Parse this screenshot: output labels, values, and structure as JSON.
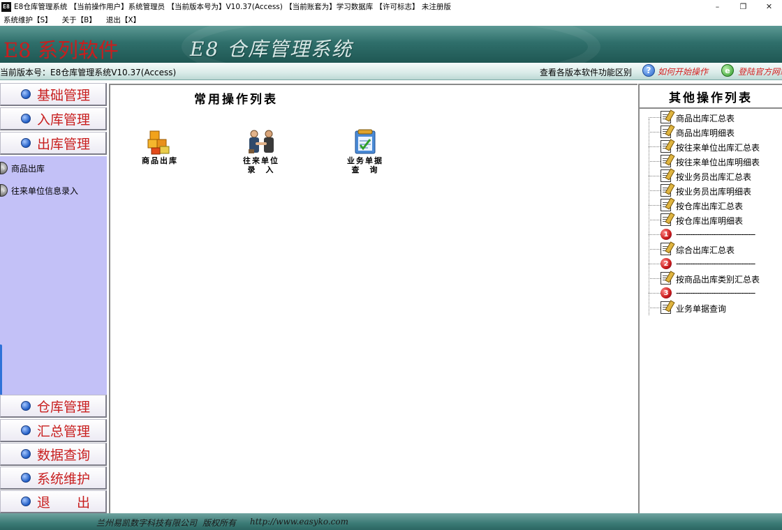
{
  "window": {
    "title": "E8仓库管理系统 【当前操作用户】系统管理员 【当前版本号为】V10.37(Access) 【当前账套为】学习数据库 【许可标志】 未注册版",
    "icon_text": "E8",
    "minimize": "–",
    "restore": "❐",
    "close": "✕"
  },
  "menu": [
    "系统维护【S】",
    "关于【B】",
    "退出【X】"
  ],
  "banner": {
    "brand": "E8 系列软件",
    "system_name": "E8 仓库管理系统",
    "version": "当前版本号：E8仓库管理系统V10.37(Access)",
    "features": "查看各版本软件功能区别",
    "help": "如何开始操作",
    "website": "登陆官方网站"
  },
  "nav_top": [
    "基础管理",
    "入库管理",
    "出库管理"
  ],
  "nav_panel_items": [
    "商品出库",
    "往来单位信息录入"
  ],
  "nav_bottom": [
    "仓库管理",
    "汇总管理",
    "数据查询",
    "系统维护",
    "退　　出"
  ],
  "center": {
    "title": "常用操作列表",
    "tiles": [
      {
        "label": "商品出库",
        "icon": "boxes-icon"
      },
      {
        "label": "往来单位\n录　入",
        "icon": "handshake-icon"
      },
      {
        "label": "业务单据\n查　询",
        "icon": "document-query-icon"
      }
    ]
  },
  "right": {
    "title": "其他操作列表",
    "items": [
      {
        "type": "report",
        "label": "商品出库汇总表"
      },
      {
        "type": "report",
        "label": "商品出库明细表"
      },
      {
        "type": "report",
        "label": "按往来单位出库汇总表"
      },
      {
        "type": "report",
        "label": "按往来单位出库明细表"
      },
      {
        "type": "report",
        "label": "按业务员出库汇总表"
      },
      {
        "type": "report",
        "label": "按业务员出库明细表"
      },
      {
        "type": "report",
        "label": "按仓库出库汇总表"
      },
      {
        "type": "report",
        "label": "按仓库出库明细表"
      },
      {
        "type": "sep",
        "num": "1",
        "label": "----------------------------------"
      },
      {
        "type": "report",
        "label": "综合出库汇总表"
      },
      {
        "type": "sep",
        "num": "2",
        "label": "----------------------------------"
      },
      {
        "type": "report",
        "label": "按商品出库类别汇总表"
      },
      {
        "type": "sep",
        "num": "3",
        "label": "----------------------------------"
      },
      {
        "type": "report",
        "label": "业务单据查询"
      }
    ]
  },
  "footer": {
    "company": "兰州易凯数字科技有限公司",
    "rights": "版权所有",
    "url": "http://www.easyko.com"
  }
}
